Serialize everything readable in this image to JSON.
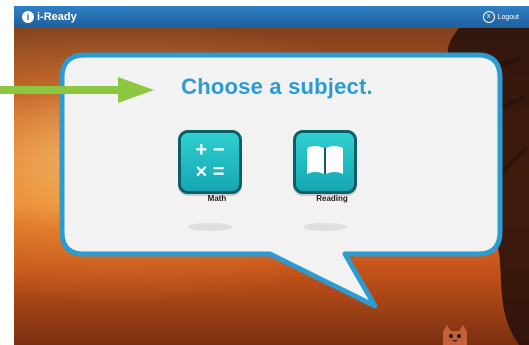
{
  "app": {
    "logo_mark": "i",
    "logo_text": "i-Ready"
  },
  "header": {
    "logout_icon": "x",
    "logout_label": "Logout"
  },
  "prompt": {
    "title": "Choose a subject."
  },
  "subjects": [
    {
      "label": "Math",
      "icon": "math-symbols-icon"
    },
    {
      "label": "Reading",
      "icon": "book-icon"
    }
  ],
  "colors": {
    "topbar": "#1f5f9e",
    "title": "#2b9bd1",
    "tile": "#16a6b3",
    "arrow": "#8dc63f"
  }
}
